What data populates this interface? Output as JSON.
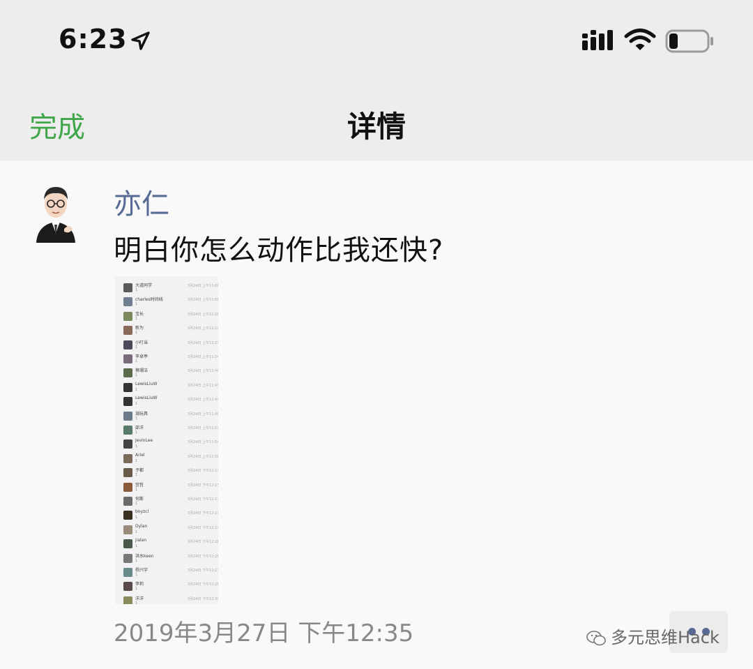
{
  "status_bar": {
    "time": "6:23",
    "icons": [
      "location-arrow-icon",
      "signal-icon",
      "wifi-icon",
      "battery-icon"
    ]
  },
  "nav": {
    "done_label": "完成",
    "title": "详情",
    "accent_color": "#3fa74a"
  },
  "post": {
    "author": "亦仁",
    "text": "明白你怎么动作比我还快?",
    "timestamp": "2019年3月27日 下午12:35",
    "author_color": "#576b95",
    "image": {
      "rows": [
        {
          "name": "大道同学",
          "num": "1",
          "time": "3月24日 上午11:08"
        },
        {
          "name": "charles时间线",
          "num": "1",
          "time": "3月24日 上午11:08"
        },
        {
          "name": "宝长",
          "num": "1",
          "time": "3月24日 上午11:08"
        },
        {
          "name": "新为",
          "num": "1",
          "time": "3月24日 上午11:10"
        },
        {
          "name": "小叮当",
          "num": "1",
          "time": "3月24日 上午11:21"
        },
        {
          "name": "李卓亭",
          "num": "1",
          "time": "3月24日 上午11:34"
        },
        {
          "name": "蔡珊洁",
          "num": "1",
          "time": "3月24日 上午11:40"
        },
        {
          "name": "LewisLiuW",
          "num": "1",
          "time": "3月24日 上午11:43"
        },
        {
          "name": "LewisLiuW",
          "num": "1",
          "time": "3月24日 上午11:43"
        },
        {
          "name": "湖玩具",
          "num": "1",
          "time": "3月24日 上午11:49"
        },
        {
          "name": "邵洋",
          "num": "1",
          "time": "3月24日 上午11:51"
        },
        {
          "name": "JevinLee",
          "num": "1",
          "time": "3月24日 上午11:54"
        },
        {
          "name": "Ariel",
          "num": "1",
          "time": "3月24日 上午11:58"
        },
        {
          "name": "子都",
          "num": "1",
          "time": "3月24日 下午12:11"
        },
        {
          "name": "宫哲",
          "num": "1",
          "time": "3月24日 下午12:15"
        },
        {
          "name": "何斯",
          "num": "1",
          "time": "3月24日 下午12:17"
        },
        {
          "name": "boyzcl",
          "num": "1",
          "time": "3月24日 下午12:19"
        },
        {
          "name": "Dylan",
          "num": "1",
          "time": "3月24日 下午12:21"
        },
        {
          "name": "jialan",
          "num": "1",
          "time": "3月24日 下午12:26"
        },
        {
          "name": "洪水keen",
          "num": "1",
          "time": "3月24日 下午12:26"
        },
        {
          "name": "杨兴宇",
          "num": "1",
          "time": "3月24日 下午12:27"
        },
        {
          "name": "李莉",
          "num": "1",
          "time": "3月24日 下午12:28"
        },
        {
          "name": "洋洋",
          "num": "1",
          "time": "3月24日 下午12:30"
        }
      ]
    }
  },
  "watermark": "多元思维Hack"
}
